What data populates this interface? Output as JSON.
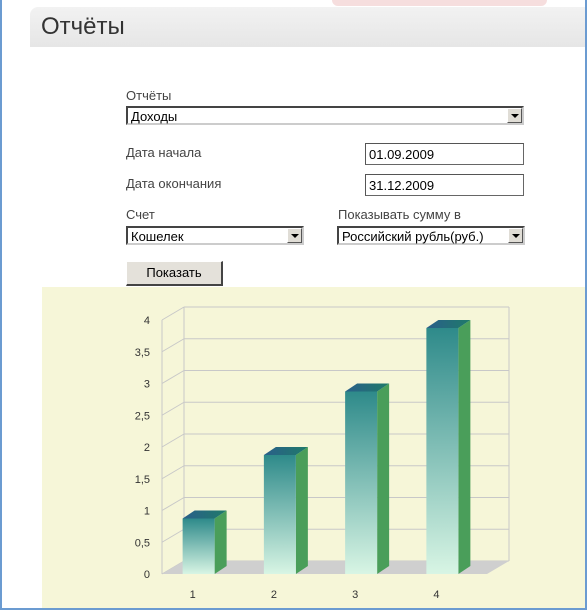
{
  "header": {
    "title": "Отчёты"
  },
  "form": {
    "report_label": "Отчёты",
    "report_value": "Доходы",
    "start_label": "Дата начала",
    "start_value": "01.09.2009",
    "end_label": "Дата окончания",
    "end_value": "31.12.2009",
    "account_label": "Счет",
    "account_value": "Кошелек",
    "currency_label": "Показывать сумму в",
    "currency_value": "Российский рубль(руб.)",
    "show_button": "Показать"
  },
  "icons": {
    "dropdown": "chevron-down-icon"
  },
  "colors": {
    "chart_background": "#f6f6d8",
    "bar_top": "#2e8a8a",
    "bar_bottom": "#d8f5e4",
    "bar_side": "#4a9e5a",
    "window_border": "#6b9bd1"
  },
  "chart_data": {
    "type": "bar",
    "categories": [
      "1",
      "2",
      "3",
      "4"
    ],
    "values": [
      1,
      2,
      3,
      4
    ],
    "yticks": [
      "0",
      "0,5",
      "1",
      "1,5",
      "2",
      "2,5",
      "3",
      "3,5",
      "4"
    ],
    "ylim": [
      0,
      4
    ],
    "grid": true,
    "title": "",
    "xlabel": "",
    "ylabel": ""
  }
}
